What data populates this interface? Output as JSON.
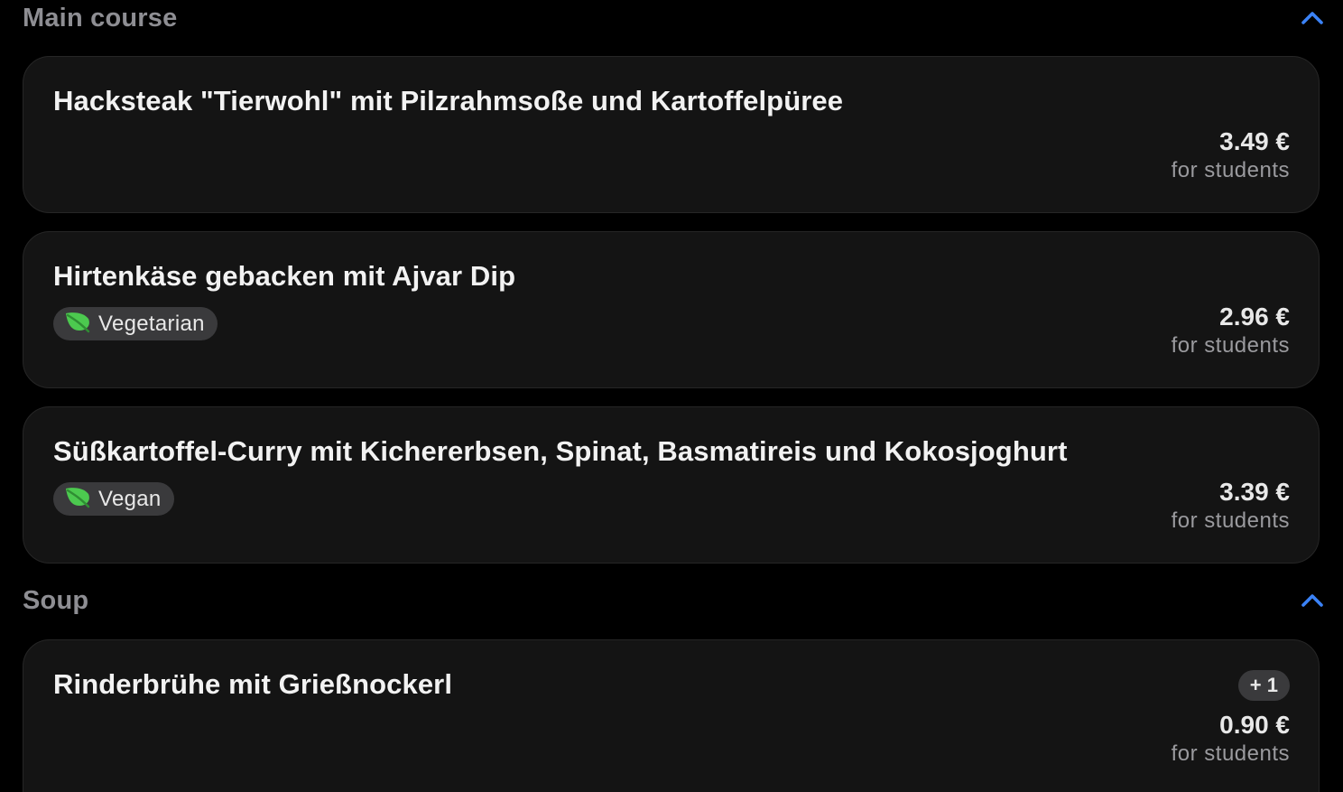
{
  "sections": [
    {
      "title": "Main course",
      "dishes": [
        {
          "name": "Hacksteak \"Tierwohl\" mit Pilzrahmsoße und Kartoffelpüree",
          "price": "3.49 €",
          "price_note": "for students"
        },
        {
          "name": "Hirtenkäse gebacken mit Ajvar Dip",
          "tag": "Vegetarian",
          "tag_icon": "leaf-icon",
          "price": "2.96 €",
          "price_note": "for students"
        },
        {
          "name": "Süßkartoffel-Curry mit Kichererbsen, Spinat, Basmatireis und Kokosjoghurt",
          "tag": "Vegan",
          "tag_icon": "leaf-icon",
          "price": "3.39 €",
          "price_note": "for students"
        }
      ]
    },
    {
      "title": "Soup",
      "dishes": [
        {
          "name": "Rinderbrühe mit Grießnockerl",
          "more_badge": "+ 1",
          "price": "0.90 €",
          "price_note": "for students"
        }
      ]
    }
  ],
  "colors": {
    "accent": "#3b82f6",
    "leaf": "#4cc94f",
    "card_background": "#141414",
    "tag_background": "#3a3a3c"
  }
}
